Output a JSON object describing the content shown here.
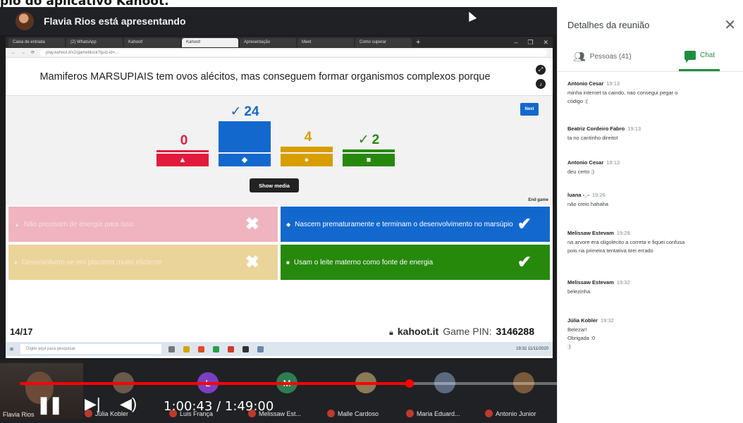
{
  "caption": "plo do aplicativo Kahoot.",
  "presenter": {
    "text": "Flavia Rios está apresentando"
  },
  "browser": {
    "tabs": [
      "Caixa de entrada",
      "(2) WhatsApp",
      "Kahoot!",
      "Kahoot!",
      "Apresentação",
      "Meet",
      "Como superar"
    ],
    "active_tab": 3,
    "url": "play.kahoot.it/v2/gameblock?quiz-id=...",
    "new_tab": "+",
    "win_controls": [
      "–",
      "❐",
      "✕"
    ]
  },
  "question": {
    "text": "Mamiferos MARSUPIAIS tem ovos alécitos, mas conseguem formar organismos complexos porque"
  },
  "results": {
    "next_label": "Next",
    "show_media_label": "Show media",
    "end_game_label": "End game",
    "bars": [
      {
        "count": "0",
        "check": "",
        "color": "#e21b3c",
        "shape": "▲",
        "share": 0.0
      },
      {
        "count": "24",
        "check": "✓",
        "color": "#1368ce",
        "shape": "◆",
        "share": 1.0
      },
      {
        "count": "4",
        "check": "",
        "color": "#d89e00",
        "shape": "●",
        "share": 0.18
      },
      {
        "count": "2",
        "check": "✓",
        "color": "#26890c",
        "shape": "■",
        "share": 0.1
      }
    ]
  },
  "answers": [
    {
      "shape": "▲",
      "text": "Não precisam de energia para isso",
      "mark": "✖",
      "style": "red",
      "correct": false
    },
    {
      "shape": "◆",
      "text": "Nascem prematuramente e terminam o desenvolvimento no marsúpio",
      "mark": "✔",
      "style": "blue",
      "correct": true
    },
    {
      "shape": "●",
      "text": "Desenvolvem-se em placenta muito eficiente",
      "mark": "✖",
      "style": "yellow",
      "correct": false
    },
    {
      "shape": "■",
      "text": "Usam o leite materno como fonte de energia",
      "mark": "✔",
      "style": "green",
      "correct": true
    }
  ],
  "footer": {
    "progress": "14/17",
    "site": "kahoot.it",
    "pin_label": "Game PIN:",
    "pin": "3146288"
  },
  "taskbar": {
    "search_placeholder": "Digite aqui para pesquisar",
    "clock": "19:32 11/11/2020"
  },
  "participants": [
    {
      "name": "Júlia Kobler",
      "initial": "",
      "color": "#6a5a4a"
    },
    {
      "name": "Luis França",
      "initial": "L",
      "color": "#7b3fbf"
    },
    {
      "name": "Melissaw Est...",
      "initial": "M",
      "color": "#2e7d4f"
    },
    {
      "name": "Malle Cardoso",
      "initial": "",
      "color": "#8a7a55"
    },
    {
      "name": "Maria Eduard...",
      "initial": "",
      "color": "#5a6a80"
    },
    {
      "name": "Antonio Junior",
      "initial": "",
      "color": "#7a5a3a"
    }
  ],
  "participant_self_name": "Flavia Rios",
  "player": {
    "time": "1:00:43 / 1:49:00",
    "played_fraction": 0.553
  },
  "panel": {
    "title": "Detalhes da reunião",
    "close": "✕",
    "people_tab": "Pessoas (41)",
    "chat_tab": "Chat",
    "messages": [
      {
        "sender": "Antonio Cesar",
        "time": "19:13",
        "lines": [
          "minha internet ta caindo, nao consegui pegar o",
          "código :("
        ]
      },
      {
        "sender": "Beatriz Cordeiro Fabro",
        "time": "19:13",
        "lines": [
          "ta no cantinho direito!"
        ]
      },
      {
        "sender": "Antonio Cesar",
        "time": "19:13",
        "lines": [
          "deu certo ;)"
        ]
      },
      {
        "sender": "luana -_-",
        "time": "19:26",
        "lines": [
          "não creio hahaha"
        ]
      },
      {
        "sender": "Melissaw Estevam",
        "time": "19:29",
        "lines": [
          "na arvore era oligolecito a correta e fiquei confusa",
          "pois na primeira tentativa tirei errado"
        ]
      },
      {
        "sender": "Melissaw Estevam",
        "time": "19:32",
        "lines": [
          "belezinha"
        ]
      },
      {
        "sender": "Júlia Kobler",
        "time": "19:32",
        "lines": [
          "Belezar!",
          "Obrigada :0",
          ":)"
        ]
      }
    ]
  }
}
